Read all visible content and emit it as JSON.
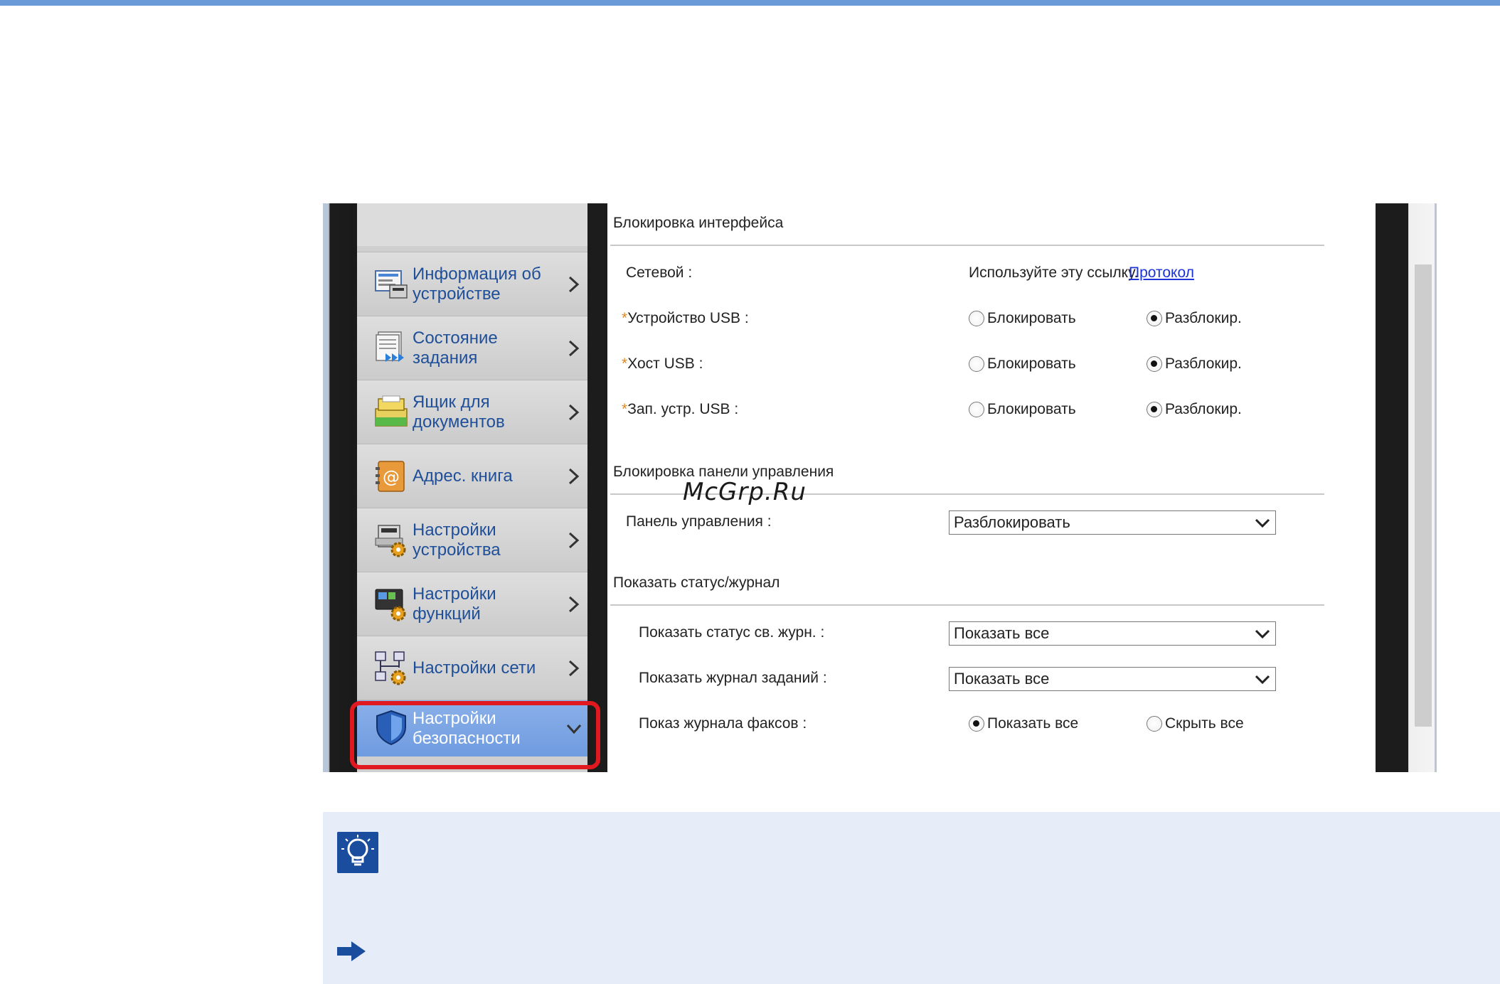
{
  "sidebar": {
    "items": [
      {
        "label_line1": "Информация об",
        "label_line2": "устройстве",
        "icon": "device-info-icon"
      },
      {
        "label_line1": "Состояние",
        "label_line2": "задания",
        "icon": "job-status-icon"
      },
      {
        "label_line1": "Ящик для",
        "label_line2": "документов",
        "icon": "document-box-icon"
      },
      {
        "label_line1": "Адрес. книга",
        "label_line2": "",
        "icon": "address-book-icon"
      },
      {
        "label_line1": "Настройки",
        "label_line2": "устройства",
        "icon": "device-settings-icon"
      },
      {
        "label_line1": "Настройки",
        "label_line2": "функций",
        "icon": "function-settings-icon"
      },
      {
        "label_line1": "Настройки сети",
        "label_line2": "",
        "icon": "network-settings-icon"
      },
      {
        "label_line1": "Настройки",
        "label_line2": "безопасности",
        "icon": "security-shield-icon"
      }
    ]
  },
  "interface_lock": {
    "title": "Блокировка интерфейса",
    "network": {
      "label": "Сетевой :",
      "text": "Используйте эту ссылку.",
      "link": "Протокол"
    },
    "usb_device": {
      "asterisk": "*",
      "label": "Устройство USB :",
      "opt1": "Блокировать",
      "opt2": "Разблокир.",
      "selected": "opt2"
    },
    "usb_host": {
      "asterisk": "*",
      "label": "Хост USB :",
      "opt1": "Блокировать",
      "opt2": "Разблокир.",
      "selected": "opt2"
    },
    "usb_storage": {
      "asterisk": "*",
      "label": "Зап. устр. USB :",
      "opt1": "Блокировать",
      "opt2": "Разблокир.",
      "selected": "opt2"
    }
  },
  "panel_lock": {
    "title": "Блокировка панели управления",
    "control_panel": {
      "label": "Панель управления :",
      "value": "Разблокировать"
    }
  },
  "status_log": {
    "title": "Показать статус/журнал",
    "show_status_log": {
      "label": "Показать статус св. журн. :",
      "value": "Показать все"
    },
    "show_job_log": {
      "label": "Показать журнал заданий :",
      "value": "Показать все"
    },
    "fax_log": {
      "label": "Показ журнала факсов :",
      "opt1": "Показать все",
      "opt2": "Скрыть все",
      "selected": "opt1"
    }
  },
  "watermark": "McGrp.Ru",
  "colors": {
    "accent": "#6b9ad8",
    "highlight": "#e0181f",
    "link": "#1b33d8",
    "tip_bg": "#e6ecf8"
  }
}
